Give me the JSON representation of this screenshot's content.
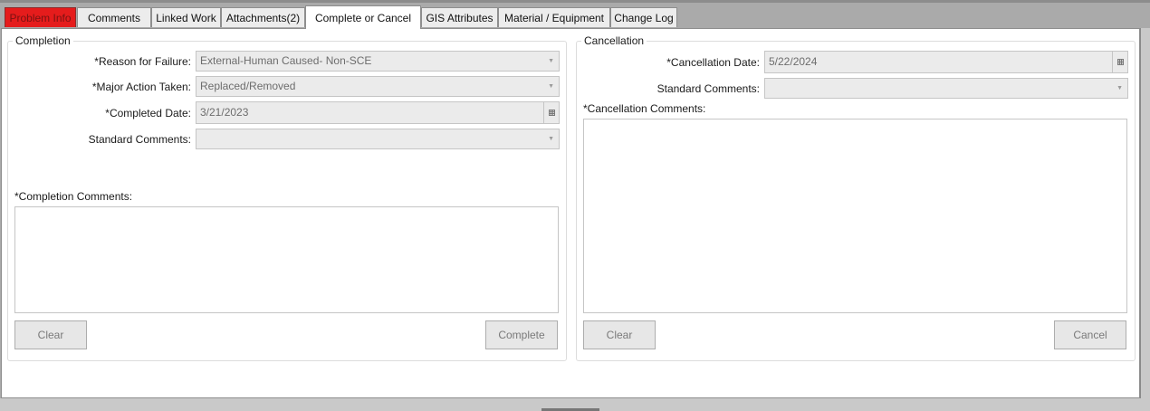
{
  "tabs": [
    {
      "label": "Problem Info"
    },
    {
      "label": "Comments"
    },
    {
      "label": "Linked Work"
    },
    {
      "label": "Attachments(2)"
    },
    {
      "label": "Complete or Cancel"
    },
    {
      "label": "GIS Attributes"
    },
    {
      "label": "Material / Equipment"
    },
    {
      "label": "Change Log"
    }
  ],
  "completion": {
    "legend": "Completion",
    "reason_label": "*Reason for Failure:",
    "reason_value": "External-Human Caused- Non-SCE",
    "action_label": "*Major Action Taken:",
    "action_value": "Replaced/Removed",
    "date_label": "*Completed Date:",
    "date_value": "3/21/2023",
    "std_comments_label": "Standard Comments:",
    "std_comments_value": "",
    "comments_label": "*Completion Comments:",
    "clear_button": "Clear",
    "complete_button": "Complete"
  },
  "cancellation": {
    "legend": "Cancellation",
    "date_label": "*Cancellation Date:",
    "date_value": "5/22/2024",
    "std_comments_label": "Standard Comments:",
    "std_comments_value": "",
    "comments_label": "*Cancellation Comments:",
    "clear_button": "Clear",
    "cancel_button": "Cancel"
  },
  "colors": {
    "alert_tab": "#e51c1c",
    "disabled_field": "#ebebeb",
    "frame": "#aaaaaa"
  }
}
